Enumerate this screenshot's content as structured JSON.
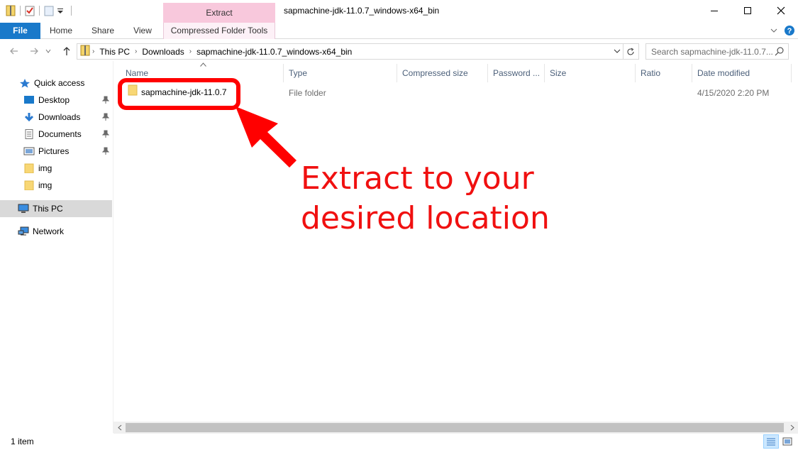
{
  "window": {
    "title": "sapmachine-jdk-11.0.7_windows-x64_bin",
    "contextual_tab": "Extract"
  },
  "ribbon": {
    "tabs": [
      "File",
      "Home",
      "Share",
      "View",
      "Compressed Folder Tools"
    ]
  },
  "address": {
    "breadcrumbs": [
      "This PC",
      "Downloads",
      "sapmachine-jdk-11.0.7_windows-x64_bin"
    ]
  },
  "search": {
    "placeholder": "Search sapmachine-jdk-11.0.7..."
  },
  "sidebar": {
    "items": [
      {
        "label": "Quick access",
        "icon": "star-icon"
      },
      {
        "label": "Desktop",
        "icon": "desktop-icon",
        "pinned": true
      },
      {
        "label": "Downloads",
        "icon": "download-icon",
        "pinned": true
      },
      {
        "label": "Documents",
        "icon": "document-icon",
        "pinned": true
      },
      {
        "label": "Pictures",
        "icon": "pictures-icon",
        "pinned": true
      },
      {
        "label": "img",
        "icon": "folder-icon"
      },
      {
        "label": "img",
        "icon": "folder-icon"
      },
      {
        "label": "This PC",
        "icon": "computer-icon",
        "selected": true
      },
      {
        "label": "Network",
        "icon": "network-icon"
      }
    ]
  },
  "columns": [
    "Name",
    "Type",
    "Compressed size",
    "Password ...",
    "Size",
    "Ratio",
    "Date modified"
  ],
  "files": [
    {
      "name": "sapmachine-jdk-11.0.7",
      "type": "File folder",
      "compressed_size": "",
      "password": "",
      "size": "",
      "ratio": "",
      "date": "4/15/2020 2:20 PM"
    }
  ],
  "annotation": {
    "text": "Extract to your\ndesired location",
    "color": "#f01010"
  },
  "status": {
    "item_count": "1 item"
  },
  "colors": {
    "file_tab": "#1979ca",
    "context_tab": "#f8c8dc",
    "highlight": "#ff0000"
  }
}
